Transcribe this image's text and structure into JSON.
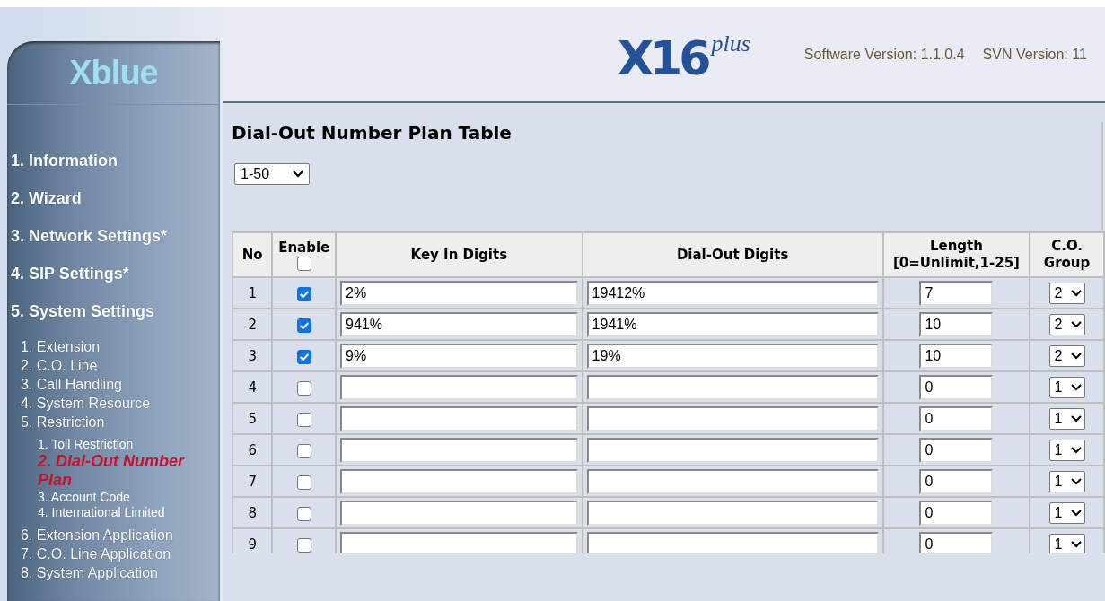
{
  "logo": {
    "text": "Xblue"
  },
  "header": {
    "product": "X16",
    "product_suffix": "plus",
    "software_version": "Software Version: 1.1.0.4",
    "svn_version": "SVN Version: 11"
  },
  "sidebar": {
    "items": [
      {
        "label": "1. Information",
        "selected": false
      },
      {
        "label": "2. Wizard",
        "selected": false
      },
      {
        "label": "3. Network Settings*",
        "selected": false
      },
      {
        "label": "4. SIP Settings*",
        "selected": false
      },
      {
        "label": "5. System Settings",
        "selected": false,
        "children": [
          {
            "label": "1. Extension",
            "selected": false
          },
          {
            "label": "2. C.O. Line",
            "selected": false
          },
          {
            "label": "3. Call Handling",
            "selected": false
          },
          {
            "label": "4. System Resource",
            "selected": false
          },
          {
            "label": "5. Restriction",
            "selected": false,
            "children": [
              {
                "label": "1. Toll Restriction",
                "selected": false
              },
              {
                "label": "2. Dial-Out Number Plan",
                "selected": true
              },
              {
                "label": "3. Account Code",
                "selected": false
              },
              {
                "label": "4. International Limited",
                "selected": false
              }
            ]
          },
          {
            "label": "6. Extension Application",
            "selected": false
          },
          {
            "label": "7. C.O. Line Application",
            "selected": false
          },
          {
            "label": "8. System Application",
            "selected": false
          }
        ]
      }
    ]
  },
  "page_title": "Dial-Out Number Plan Table",
  "range_select": {
    "value": "1-50"
  },
  "table": {
    "columns": [
      {
        "label": "No"
      },
      {
        "label": "Enable",
        "checked": false
      },
      {
        "label": "Key In Digits"
      },
      {
        "label": "Dial-Out Digits"
      },
      {
        "label": "Length",
        "sublabel": "[0=Unlimit,1-25]"
      },
      {
        "label": "C.O.",
        "sublabel": "Group"
      }
    ],
    "rows": [
      {
        "no": "1",
        "enabled": true,
        "key_in": "2%",
        "dial_out": "19412%",
        "length": "7",
        "co_group": "2"
      },
      {
        "no": "2",
        "enabled": true,
        "key_in": "941%",
        "dial_out": "1941%",
        "length": "10",
        "co_group": "2"
      },
      {
        "no": "3",
        "enabled": true,
        "key_in": "9%",
        "dial_out": "19%",
        "length": "10",
        "co_group": "2"
      },
      {
        "no": "4",
        "enabled": false,
        "length": "0",
        "co_group": "1"
      },
      {
        "no": "5",
        "enabled": false,
        "length": "0",
        "co_group": "1"
      },
      {
        "no": "6",
        "enabled": false,
        "length": "0",
        "co_group": "1"
      },
      {
        "no": "7",
        "enabled": false,
        "length": "0",
        "co_group": "1"
      },
      {
        "no": "8",
        "enabled": false,
        "length": "0",
        "co_group": "1"
      },
      {
        "no": "9",
        "enabled": false,
        "length": "0",
        "co_group": "1"
      }
    ]
  }
}
